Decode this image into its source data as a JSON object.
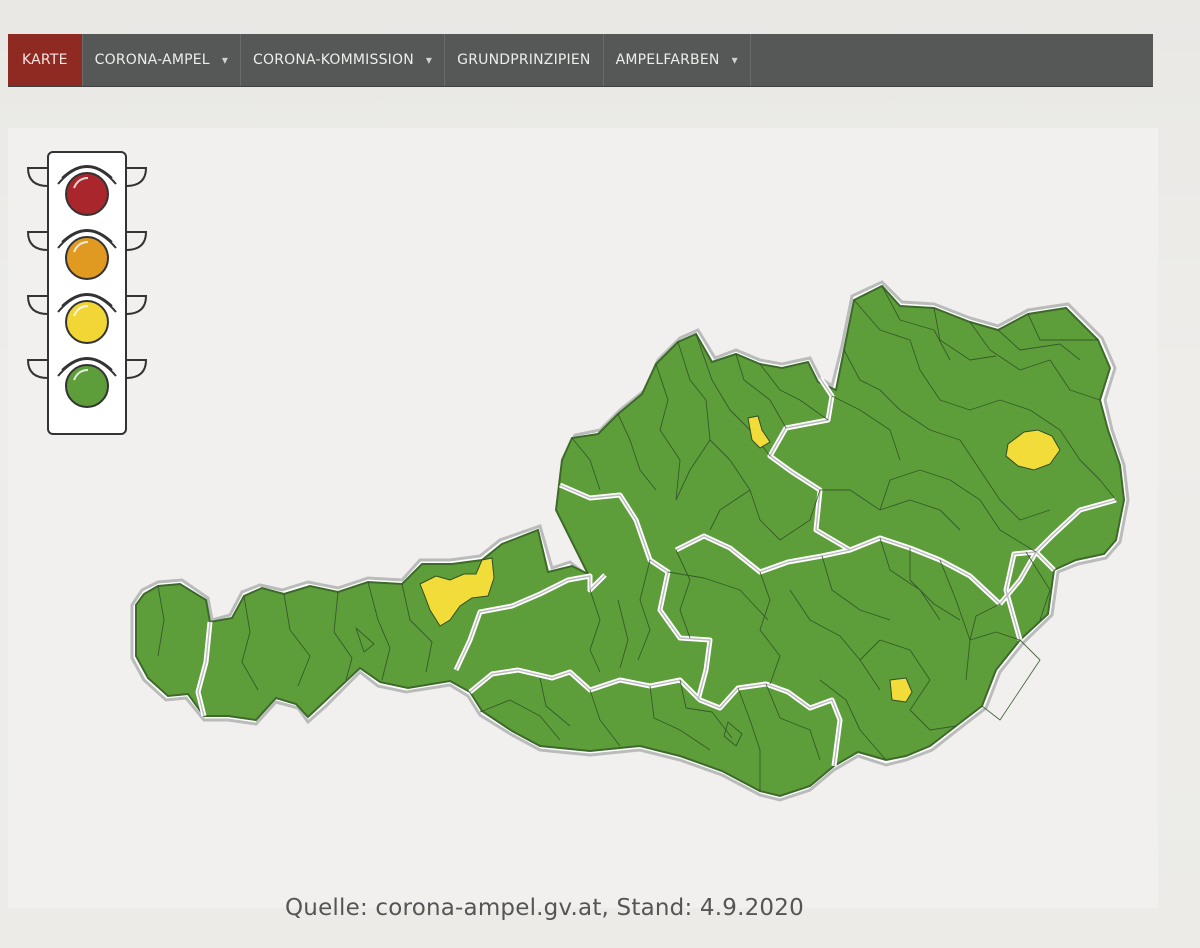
{
  "nav": {
    "items": [
      {
        "label": "KARTE",
        "dropdown": false,
        "active": true
      },
      {
        "label": "CORONA-AMPEL",
        "dropdown": true,
        "active": false
      },
      {
        "label": "CORONA-KOMMISSION",
        "dropdown": true,
        "active": false
      },
      {
        "label": "GRUNDPRINZIPIEN",
        "dropdown": false,
        "active": false
      },
      {
        "label": "AMPELFARBEN",
        "dropdown": true,
        "active": false
      }
    ],
    "caret": "▾"
  },
  "legend": {
    "lights": [
      {
        "level": "red",
        "color": "#a8262c"
      },
      {
        "level": "orange",
        "color": "#e09a22"
      },
      {
        "level": "yellow",
        "color": "#f2d635"
      },
      {
        "level": "green",
        "color": "#5d9e3a"
      }
    ]
  },
  "map": {
    "colors": {
      "green": "#5d9e3a",
      "yellow": "#f2dc3a",
      "border": "#2f4f25"
    },
    "yellow_districts": [
      "Kufstein",
      "Linz",
      "Wien",
      "Graz"
    ]
  },
  "caption": "Quelle: corona-ampel.gv.at, Stand: 4.9.2020"
}
